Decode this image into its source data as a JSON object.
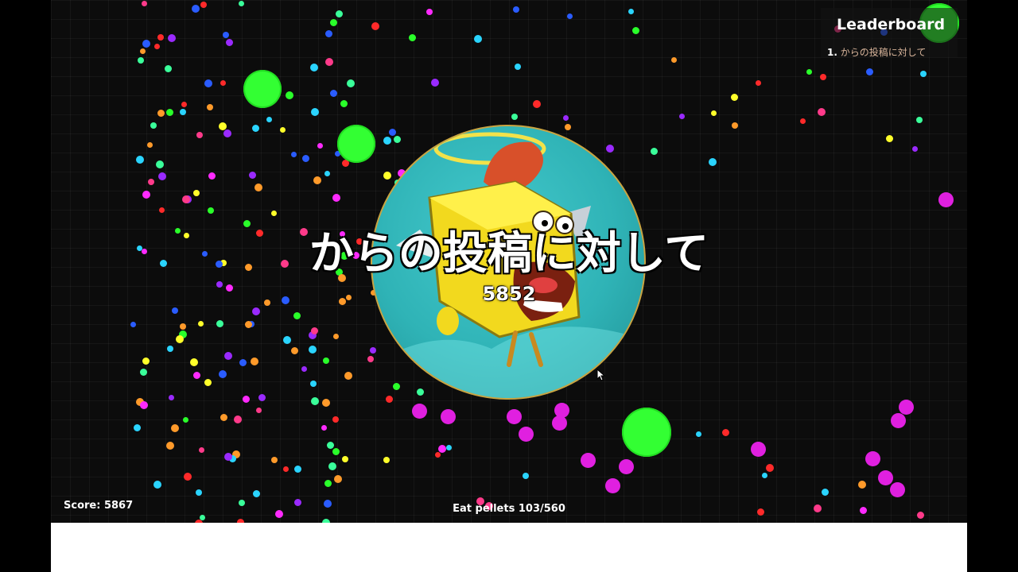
{
  "player": {
    "name": "からの投稿に対して",
    "mass": "5852"
  },
  "leaderboard": {
    "title": "Leaderboard",
    "entries": [
      {
        "rank": "1.",
        "name": "からの投稿に対して"
      }
    ]
  },
  "hud": {
    "score": "Score: 5867",
    "quest": "Eat pellets 103/560"
  },
  "colors": {
    "virus": "#33ff33",
    "background": "#0c0c0c",
    "player_border": "#c9a442"
  }
}
